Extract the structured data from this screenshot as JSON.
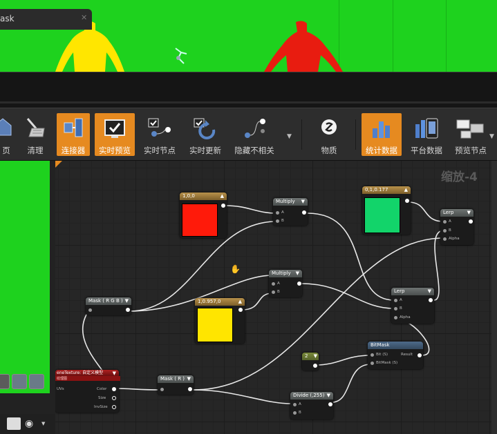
{
  "tab": {
    "title": "ask",
    "close": "✕"
  },
  "toolbar": {
    "buttons": [
      {
        "label": "页",
        "active": false
      },
      {
        "label": "清理",
        "active": false
      },
      {
        "label": "连接器",
        "active": true
      },
      {
        "label": "实时预览",
        "active": true
      },
      {
        "label": "实时节点",
        "active": false
      },
      {
        "label": "实时更新",
        "active": false
      },
      {
        "label": "隐藏不相关",
        "active": false
      },
      {
        "label": "物质",
        "active": false
      },
      {
        "label": "统计数据",
        "active": true
      },
      {
        "label": "平台数据",
        "active": false
      },
      {
        "label": "预览节点",
        "active": false
      }
    ]
  },
  "graph": {
    "zoom": "缩放-4",
    "nodes": {
      "const_red": {
        "title": "1,0,0",
        "color": "#ff1a0a"
      },
      "const_green": {
        "title": "0,1,0.177",
        "color": "#12d46a"
      },
      "const_yellow": {
        "title": "1,0.957,0",
        "color": "#ffe500"
      },
      "multiply1": {
        "title": "Multiply",
        "pins": [
          "A",
          "B"
        ]
      },
      "multiply2": {
        "title": "Multiply",
        "pins": [
          "A",
          "B"
        ]
      },
      "lerp1": {
        "title": "Lerp",
        "pins": [
          "A",
          "B",
          "Alpha"
        ]
      },
      "lerp2": {
        "title": "Lerp",
        "pins": [
          "A",
          "B",
          "Alpha"
        ]
      },
      "mask_rgb": {
        "title": "Mask ( R G B )"
      },
      "mask_r": {
        "title": "Mask ( R )"
      },
      "bitmask": {
        "title": "BitMask",
        "pins": [
          "Bit (S)",
          "BitMask (S)"
        ],
        "output": "Result"
      },
      "const2": {
        "title": "2"
      },
      "divide": {
        "title": "Divide (,255)",
        "pins": [
          "A",
          "B"
        ]
      },
      "texture": {
        "title": "eneTexture: 自定义模型",
        "subtitle": "纹理图",
        "inputs": [
          "UVs"
        ],
        "outputs": [
          "Color",
          "Size",
          "InvSize"
        ]
      }
    }
  },
  "icons": {
    "tb0": "home-icon",
    "tb1": "broom-icon",
    "tb2": "connector-icon",
    "tb3": "live-preview-icon",
    "tb4": "live-nodes-icon",
    "tb5": "live-update-icon",
    "tb6": "hide-unrelated-icon",
    "tb7": "material-icon",
    "tb8": "stats-icon",
    "tb9": "platform-stats-icon",
    "tb10": "preview-node-icon"
  }
}
